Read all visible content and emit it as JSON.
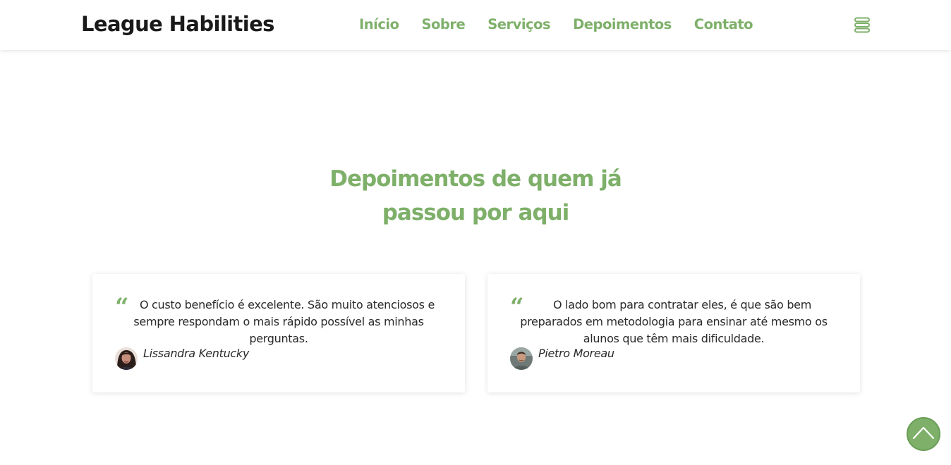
{
  "header": {
    "logo": "League Habilities",
    "nav": [
      "Início",
      "Sobre",
      "Serviços",
      "Depoimentos",
      "Contato"
    ],
    "menu_icon": "hamburger-stack-icon"
  },
  "testimonials": {
    "title_line1": "Depoimentos de quem já",
    "title_line2": "passou por aqui",
    "cards": [
      {
        "quote_mark": "“",
        "text": "O custo benefício é excelente. São muito atenciosos e sempre respondam o mais rápido possível as minhas perguntas.",
        "author": "Lissandra Kentucky",
        "avatar": "avatar-female"
      },
      {
        "quote_mark": "“",
        "text": "O lado bom para contratar eles, é que são bem preparados em metodologia para ensinar até mesmo os alunos que têm mais dificuldade.",
        "author": "Pietro Moreau",
        "avatar": "avatar-male"
      }
    ]
  },
  "back_to_top_icon": "chevron-up-icon",
  "colors": {
    "accent": "#7eb06a",
    "text": "#2a2a2a",
    "logo": "#1a1a1a",
    "background": "#ffffff"
  }
}
